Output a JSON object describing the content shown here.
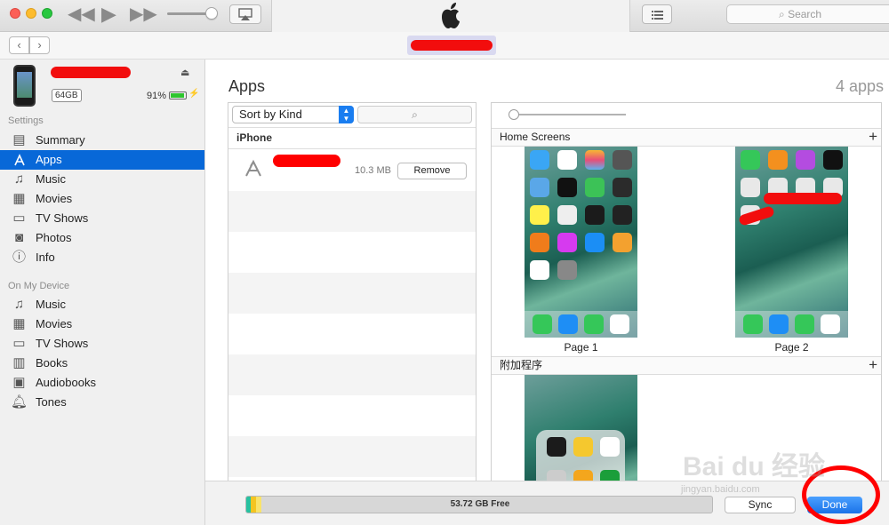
{
  "toolbar": {
    "search_placeholder": "Search"
  },
  "device": {
    "capacity": "64GB",
    "battery_pct": "91%",
    "battery_level": 0.91,
    "charging_glyph": "⚡"
  },
  "sidebar": {
    "settings_label": "Settings",
    "settings_items": [
      {
        "label": "Summary",
        "icon": "summary-icon"
      },
      {
        "label": "Apps",
        "icon": "apps-icon",
        "active": true
      },
      {
        "label": "Music",
        "icon": "music-icon"
      },
      {
        "label": "Movies",
        "icon": "movies-icon"
      },
      {
        "label": "TV Shows",
        "icon": "tv-icon"
      },
      {
        "label": "Photos",
        "icon": "camera-icon"
      },
      {
        "label": "Info",
        "icon": "info-icon"
      }
    ],
    "device_label": "On My Device",
    "device_items": [
      {
        "label": "Music",
        "icon": "music-icon"
      },
      {
        "label": "Movies",
        "icon": "movies-icon"
      },
      {
        "label": "TV Shows",
        "icon": "tv-icon"
      },
      {
        "label": "Books",
        "icon": "book-icon"
      },
      {
        "label": "Audiobooks",
        "icon": "audiobook-icon"
      },
      {
        "label": "Tones",
        "icon": "bell-icon"
      }
    ]
  },
  "main": {
    "title": "Apps",
    "app_count": "4 apps",
    "sort_label": "Sort by Kind",
    "group_header": "iPhone",
    "app_row": {
      "size": "10.3 MB",
      "remove_label": "Remove"
    },
    "home_screens_label": "Home Screens",
    "page1_label": "Page 1",
    "page2_label": "Page 2",
    "additional_label": "附加程序"
  },
  "footer": {
    "storage_free": "53.72 GB Free",
    "sync_label": "Sync",
    "done_label": "Done"
  },
  "watermark": {
    "brand": "Bai du 经验",
    "url": "jingyan.baidu.com"
  },
  "colors": {
    "accent": "#0868d8",
    "redaction": "#f20d0d"
  }
}
